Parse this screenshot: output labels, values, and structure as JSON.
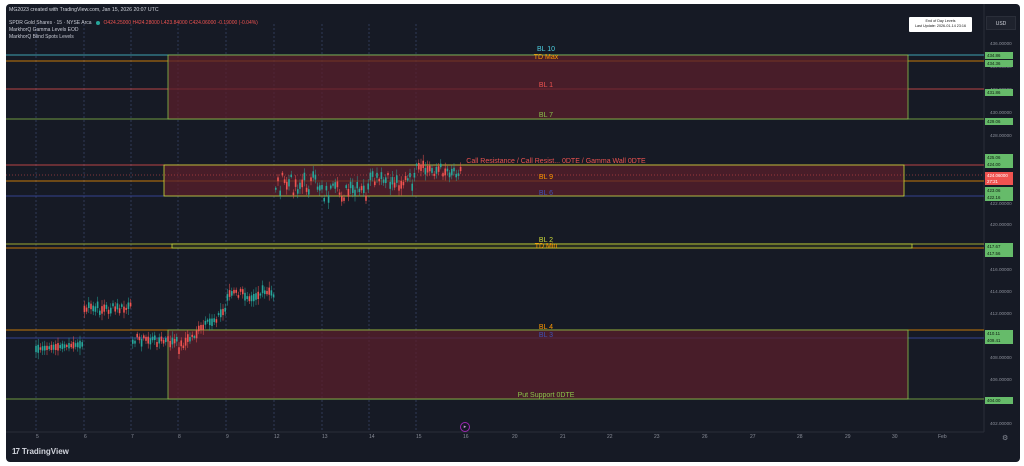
{
  "header": {
    "creator": "MG2023 created with TradingView.com, Jan 15, 2026 20:07 UTC",
    "symbol": "SPDR Gold Shares · 15 · NYSE Arca",
    "ohlc": "O424.25000 H424.28000 L423.84000 C424.06000 -0.19000 (-0.04%)",
    "indicator1": "MarkhorQ Gamma Levels EOD",
    "indicator2": "MarkhorQ Blind Spots Levels"
  },
  "update_box": {
    "line1": "End of Day Levels",
    "line2": "Last Update: 2026-01-14 23:16"
  },
  "currency": "USD",
  "price_axis": {
    "ticks": [
      "436.00000",
      "434.00000",
      "432.00000",
      "430.00000",
      "428.00000",
      "426.00000",
      "424.00000",
      "422.00000",
      "420.00000",
      "418.00000",
      "416.00000",
      "414.00000",
      "412.00000",
      "410.00000",
      "408.00000",
      "406.00000",
      "404.00000",
      "402.00000"
    ],
    "badges": [
      {
        "text": "434.86",
        "color": "green"
      },
      {
        "text": "434.36",
        "color": "green"
      },
      {
        "text": "431.86",
        "color": "green"
      },
      {
        "text": "429.06",
        "color": "green"
      },
      {
        "text": "425.06",
        "color": "green"
      },
      {
        "text": "424.00",
        "color": "green"
      },
      {
        "text": "424.06000",
        "color": "red"
      },
      {
        "text": "27:21",
        "color": "red"
      },
      {
        "text": "423.06",
        "color": "green"
      },
      {
        "text": "422.16",
        "color": "green"
      },
      {
        "text": "417.67",
        "color": "green"
      },
      {
        "text": "417.56",
        "color": "green"
      },
      {
        "text": "410.11",
        "color": "green"
      },
      {
        "text": "409.41",
        "color": "green"
      },
      {
        "text": "404.00",
        "color": "green"
      }
    ]
  },
  "time_axis": [
    "5",
    "6",
    "7",
    "8",
    "9",
    "12",
    "13",
    "14",
    "15",
    "16",
    "20",
    "21",
    "22",
    "23",
    "26",
    "27",
    "28",
    "29",
    "30",
    "Feb"
  ],
  "levels": {
    "bl10": "BL 10",
    "td_max": "TD Max",
    "bl1": "BL 1",
    "bl7": "BL 7",
    "call_resistance": "Call Resistance / Call Resist... 0DTE / Gamma Wall 0DTE",
    "bl9": "BL 9",
    "bl6": "BL 6",
    "bl2": "BL 2",
    "td_min": "TD Min",
    "bl4": "BL 4",
    "bl3": "BL 3",
    "put_support": "Put Support 0DTE"
  },
  "colors": {
    "background": "#161a25",
    "zone_fill": "#5a1f2b",
    "zone_border": "#8bc34a",
    "bullish": "#26a69a",
    "bearish": "#ef5350",
    "bl_teal": "#4dd0e1",
    "bl_orange": "#ff9800",
    "bl_red": "#ef5350",
    "bl_green": "#8bc34a",
    "bl_blue": "#3f51b5",
    "bl_yellow": "#cddc39"
  },
  "footer": {
    "brand": "TradingView",
    "replay_icon": "replay-icon",
    "settings_icon": "gear-icon"
  }
}
